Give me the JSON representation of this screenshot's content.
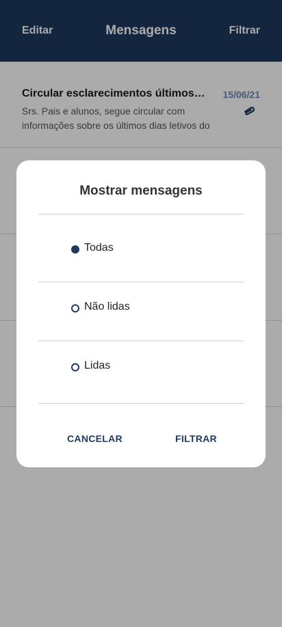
{
  "header": {
    "edit_label": "Editar",
    "title": "Mensagens",
    "filter_label": "Filtrar"
  },
  "messages": [
    {
      "subject": "Circular esclarecimentos últimos dias letivos",
      "preview": "Srs. Pais e alunos, segue circular com informações sobre os últimos dias letivos do semestre.",
      "date": "15/06/21",
      "has_attachment": true
    }
  ],
  "dialog": {
    "title": "Mostrar mensagens",
    "options": [
      {
        "label": "Todas",
        "selected": true
      },
      {
        "label": "Não lidas",
        "selected": false
      },
      {
        "label": "Lidas",
        "selected": false
      }
    ],
    "cancel_label": "CANCELAR",
    "confirm_label": "FILTRAR"
  },
  "colors": {
    "primary": "#1e3a5f",
    "date": "#6b88b0"
  }
}
